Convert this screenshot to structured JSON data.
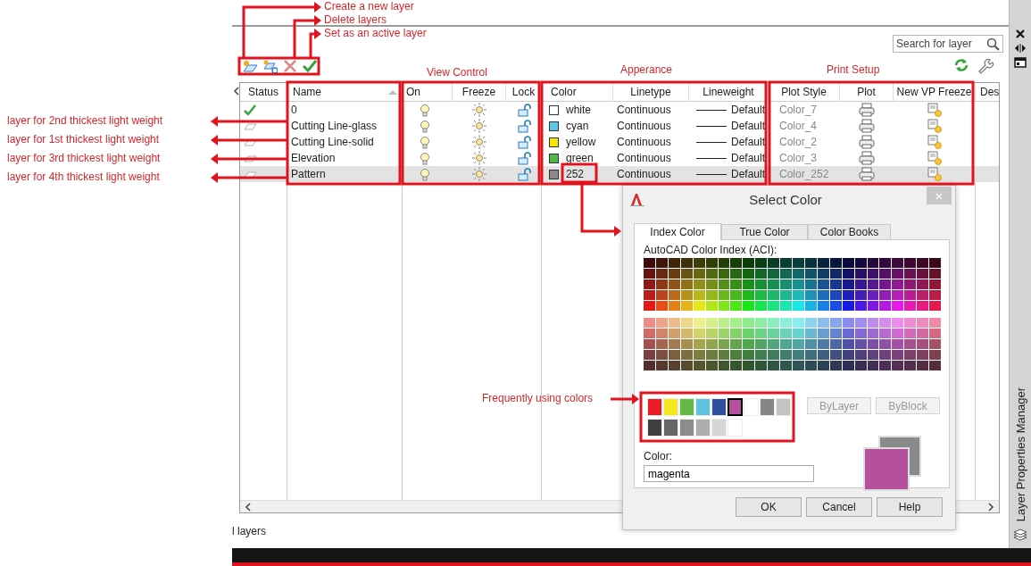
{
  "annotations": {
    "toolbar_notes": [
      "Create a new layer",
      "Delete layers",
      "Set as an active layer"
    ],
    "group_notes": [
      "View Control",
      "Apperance",
      "Print Setup"
    ],
    "row_notes": [
      "layer for 2nd thickest light weight",
      "layer for 1st thickest light weight",
      "layer for 3rd thickest light weight",
      "layer for 4th thickest light weight"
    ],
    "swatch_note": "Frequently using colors"
  },
  "search": {
    "placeholder": "Search for layer"
  },
  "columns": [
    "Status",
    "Name",
    "On",
    "Freeze",
    "Lock",
    "Color",
    "Linetype",
    "Lineweight",
    "Plot Style",
    "Plot",
    "New VP Freeze",
    "Des"
  ],
  "layers": [
    {
      "kind": "current",
      "name": "0",
      "on": true,
      "frozen": false,
      "locked": false,
      "color_name": "white",
      "color": "#ffffff",
      "linetype": "Continuous",
      "lineweight": "Default",
      "plot_style": "Color_7",
      "plot": true,
      "selected": false
    },
    {
      "kind": "normal",
      "name": "Cutting Line-glass",
      "on": true,
      "frozen": false,
      "locked": false,
      "color_name": "cyan",
      "color": "#5ac8e0",
      "linetype": "Continuous",
      "lineweight": "Default",
      "plot_style": "Color_4",
      "plot": true,
      "selected": false
    },
    {
      "kind": "normal",
      "name": "Cutting Line-solid",
      "on": true,
      "frozen": false,
      "locked": false,
      "color_name": "yellow",
      "color": "#f7e600",
      "linetype": "Continuous",
      "lineweight": "Default",
      "plot_style": "Color_2",
      "plot": true,
      "selected": false
    },
    {
      "kind": "normal",
      "name": "Elevation",
      "on": true,
      "frozen": false,
      "locked": false,
      "color_name": "green",
      "color": "#4fb848",
      "linetype": "Continuous",
      "lineweight": "Default",
      "plot_style": "Color_3",
      "plot": true,
      "selected": false
    },
    {
      "kind": "normal",
      "name": "Pattern",
      "on": true,
      "frozen": false,
      "locked": false,
      "color_name": "252",
      "color": "#8a8a8a",
      "linetype": "Continuous",
      "lineweight": "Default",
      "plot_style": "Color_252",
      "plot": true,
      "selected": true
    }
  ],
  "status_bar": "l layers",
  "side_panel": {
    "title": "Layer Properties Manager"
  },
  "dialog": {
    "title": "Select Color",
    "close": "×",
    "tabs": [
      {
        "label": "Index Color",
        "selected": true
      },
      {
        "label": "True Color",
        "selected": false
      },
      {
        "label": "Color Books",
        "selected": false
      }
    ],
    "palette_label": "AutoCAD Color Index (ACI):",
    "recent_colors": [
      {
        "color": "#ed1c24",
        "selected": false
      },
      {
        "color": "#f5e61e",
        "selected": false
      },
      {
        "color": "#62b946",
        "selected": false
      },
      {
        "color": "#5cc3de",
        "selected": false
      },
      {
        "color": "#2e4ea1",
        "selected": false
      },
      {
        "color": "#b5509f",
        "selected": true
      },
      {
        "color": "#ffffff",
        "selected": false
      },
      {
        "color": "#868686",
        "selected": false
      },
      {
        "color": "#c3c3c3",
        "selected": false
      }
    ],
    "gray_colors": [
      {
        "color": "#404040",
        "selected": false
      },
      {
        "color": "#666666",
        "selected": false
      },
      {
        "color": "#8c8c8c",
        "selected": false
      },
      {
        "color": "#adadad",
        "selected": false
      },
      {
        "color": "#d6d6d6",
        "selected": false
      },
      {
        "color": "#ffffff",
        "selected": false
      }
    ],
    "logic_buttons": [
      {
        "label": "ByLayer",
        "disabled": true
      },
      {
        "label": "ByBlock",
        "disabled": true
      }
    ],
    "color_label": "Color:",
    "color_value": "magenta",
    "buttons": [
      "OK",
      "Cancel",
      "Help"
    ]
  }
}
